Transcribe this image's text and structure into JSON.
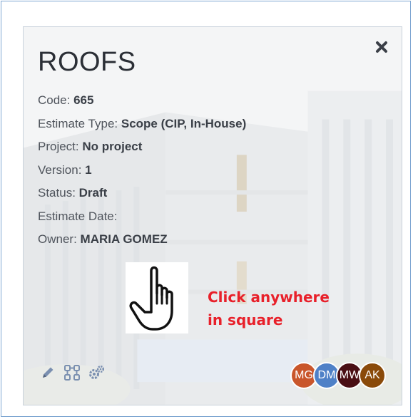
{
  "card": {
    "title": "ROOFS",
    "close_icon": "close-icon",
    "fields": [
      {
        "label": "Code: ",
        "value": "665"
      },
      {
        "label": "Estimate Type: ",
        "value": "Scope (CIP, In-House)"
      },
      {
        "label": "Project: ",
        "value": "No project"
      },
      {
        "label": "Version: ",
        "value": "1"
      },
      {
        "label": "Status: ",
        "value": "Draft"
      },
      {
        "label": "Estimate Date: ",
        "value": ""
      },
      {
        "label": "Owner: ",
        "value": "MARIA GOMEZ"
      }
    ],
    "toolbar": {
      "icons": [
        "pencil-icon",
        "workflow-icon",
        "gears-icon"
      ]
    },
    "avatars": [
      {
        "initials": "MG",
        "color": "#c9562b"
      },
      {
        "initials": "DM",
        "color": "#4f81c7"
      },
      {
        "initials": "MW",
        "color": "#4a0f14"
      },
      {
        "initials": "AK",
        "color": "#8a4a0a"
      }
    ]
  },
  "annotation": {
    "hand_icon": "pointing-hand-icon",
    "line1": "Click anywhere",
    "line2": "in square",
    "color": "#e8202a"
  }
}
